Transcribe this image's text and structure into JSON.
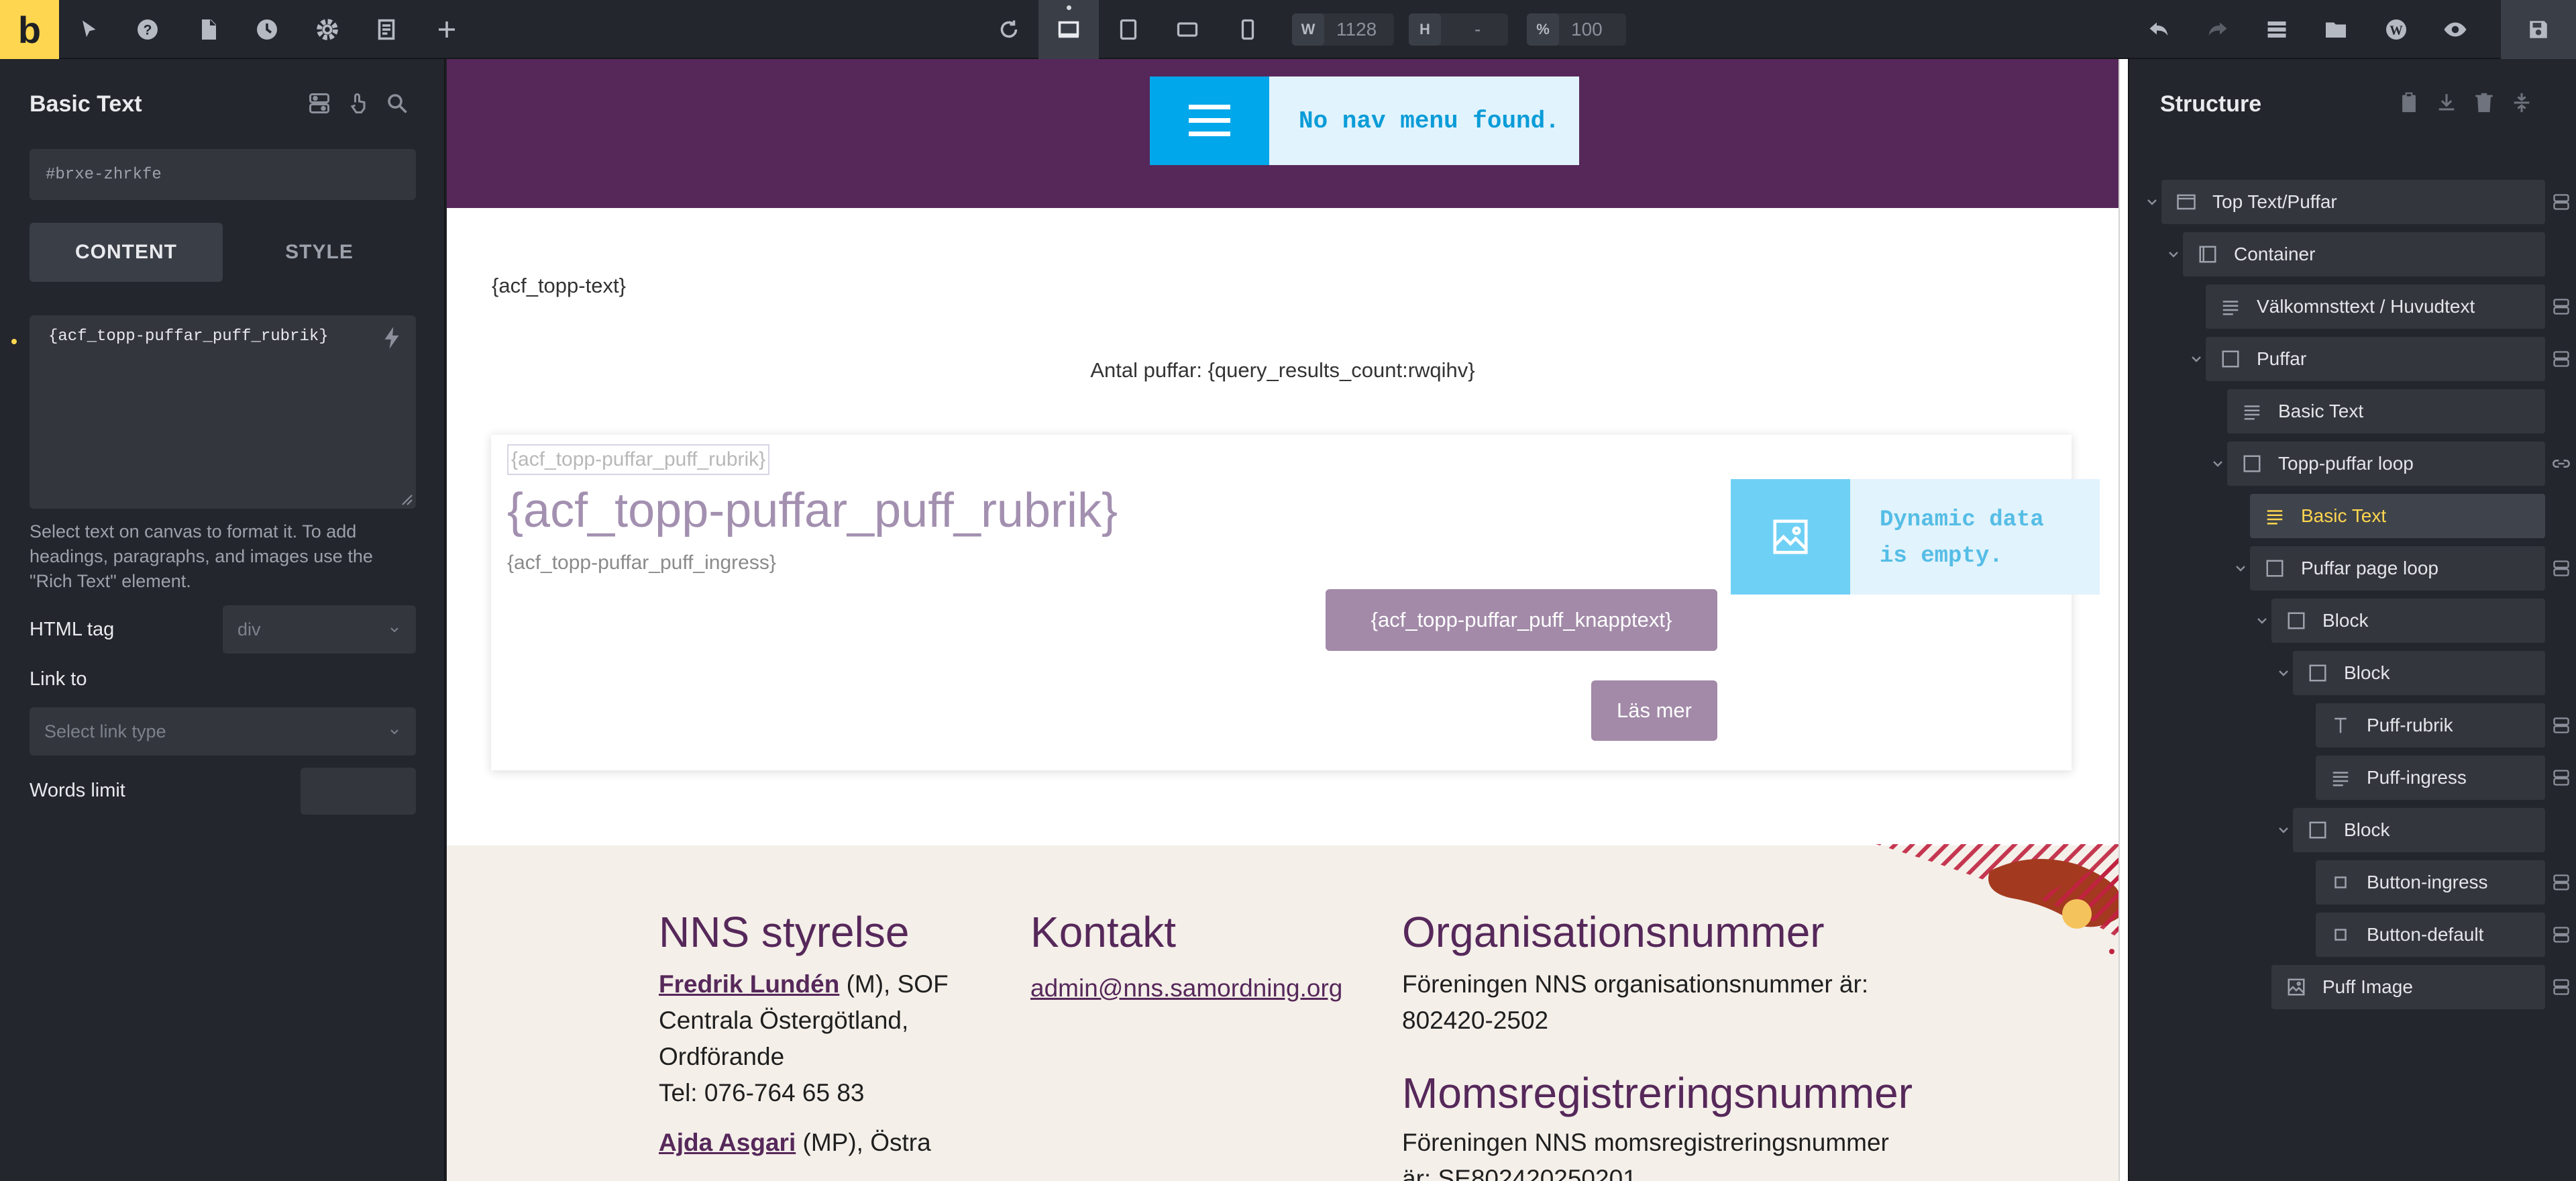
{
  "toolbar": {
    "logo": "b",
    "width_label": "W",
    "width_value": "1128",
    "height_label": "H",
    "height_value": "-",
    "percent_label": "%",
    "percent_value": "100"
  },
  "left_panel": {
    "title": "Basic Text",
    "element_id": "#brxe-zhrkfe",
    "tabs": [
      "CONTENT",
      "STYLE"
    ],
    "text_value": "{acf_topp-puffar_puff_rubrik}",
    "help_text": "Select text on canvas to format it. To add headings, paragraphs, and images use the \"Rich Text\" element.",
    "html_tag_label": "HTML tag",
    "html_tag_value": "div",
    "link_label": "Link to",
    "link_placeholder": "Select link type",
    "words_limit_label": "Words limit"
  },
  "canvas": {
    "nav_message": "No nav menu found.",
    "topp_text": "{acf_topp-text}",
    "count_text": "Antal puffar: {query_results_count:rwqihv}",
    "card": {
      "selected_text": "{acf_topp-puffar_puff_rubrik}",
      "rubrik": "{acf_topp-puffar_puff_rubrik}",
      "ingress": "{acf_topp-puffar_puff_ingress}",
      "button_text": "{acf_topp-puffar_puff_knapptext}",
      "more_button": "Läs mer",
      "image_message_line1": "Dynamic data",
      "image_message_line2": "is empty."
    },
    "footer": {
      "board_heading": "NNS styrelse",
      "member1_name": "Fredrik Lundén",
      "member1_rest1": " (M), SOF",
      "member1_line2": "Centrala Östergötland,",
      "member1_line3": "Ordförande",
      "member1_phone": "Tel: 076-764 65 83",
      "member2_name": "Ajda Asgari",
      "member2_rest": " (MP), Östra",
      "contact_heading": "Kontakt",
      "contact_email": "admin@nns.samordning.org",
      "org_heading": "Organisationsnummer",
      "org_line1": "Föreningen NNS organisationsnummer är:",
      "org_line2": "802420-2502",
      "vat_heading": "Momsregistreringsnummer",
      "vat_line1": "Föreningen NNS momsregistreringsnummer",
      "vat_line2": "är: SE802420250201"
    }
  },
  "structure": {
    "title": "Structure",
    "nodes": [
      {
        "label": "Top Text/Puffar",
        "icon": "section-icon"
      },
      {
        "label": "Container",
        "icon": "container-icon"
      },
      {
        "label": "Välkomnsttext / Huvudtext",
        "icon": "text-lines-icon"
      },
      {
        "label": "Puffar",
        "icon": "block-icon"
      },
      {
        "label": "Basic Text",
        "icon": "text-lines-icon"
      },
      {
        "label": "Topp-puffar loop",
        "icon": "block-icon"
      },
      {
        "label": "Basic Text",
        "icon": "text-lines-icon"
      },
      {
        "label": "Puffar page loop",
        "icon": "block-icon"
      },
      {
        "label": "Block",
        "icon": "block-icon"
      },
      {
        "label": "Block",
        "icon": "block-icon"
      },
      {
        "label": "Puff-rubrik",
        "icon": "heading-icon"
      },
      {
        "label": "Puff-ingress",
        "icon": "text-lines-icon"
      },
      {
        "label": "Block",
        "icon": "block-icon"
      },
      {
        "label": "Button-ingress",
        "icon": "button-icon"
      },
      {
        "label": "Button-default",
        "icon": "button-icon"
      },
      {
        "label": "Puff Image",
        "icon": "image-icon"
      }
    ]
  }
}
